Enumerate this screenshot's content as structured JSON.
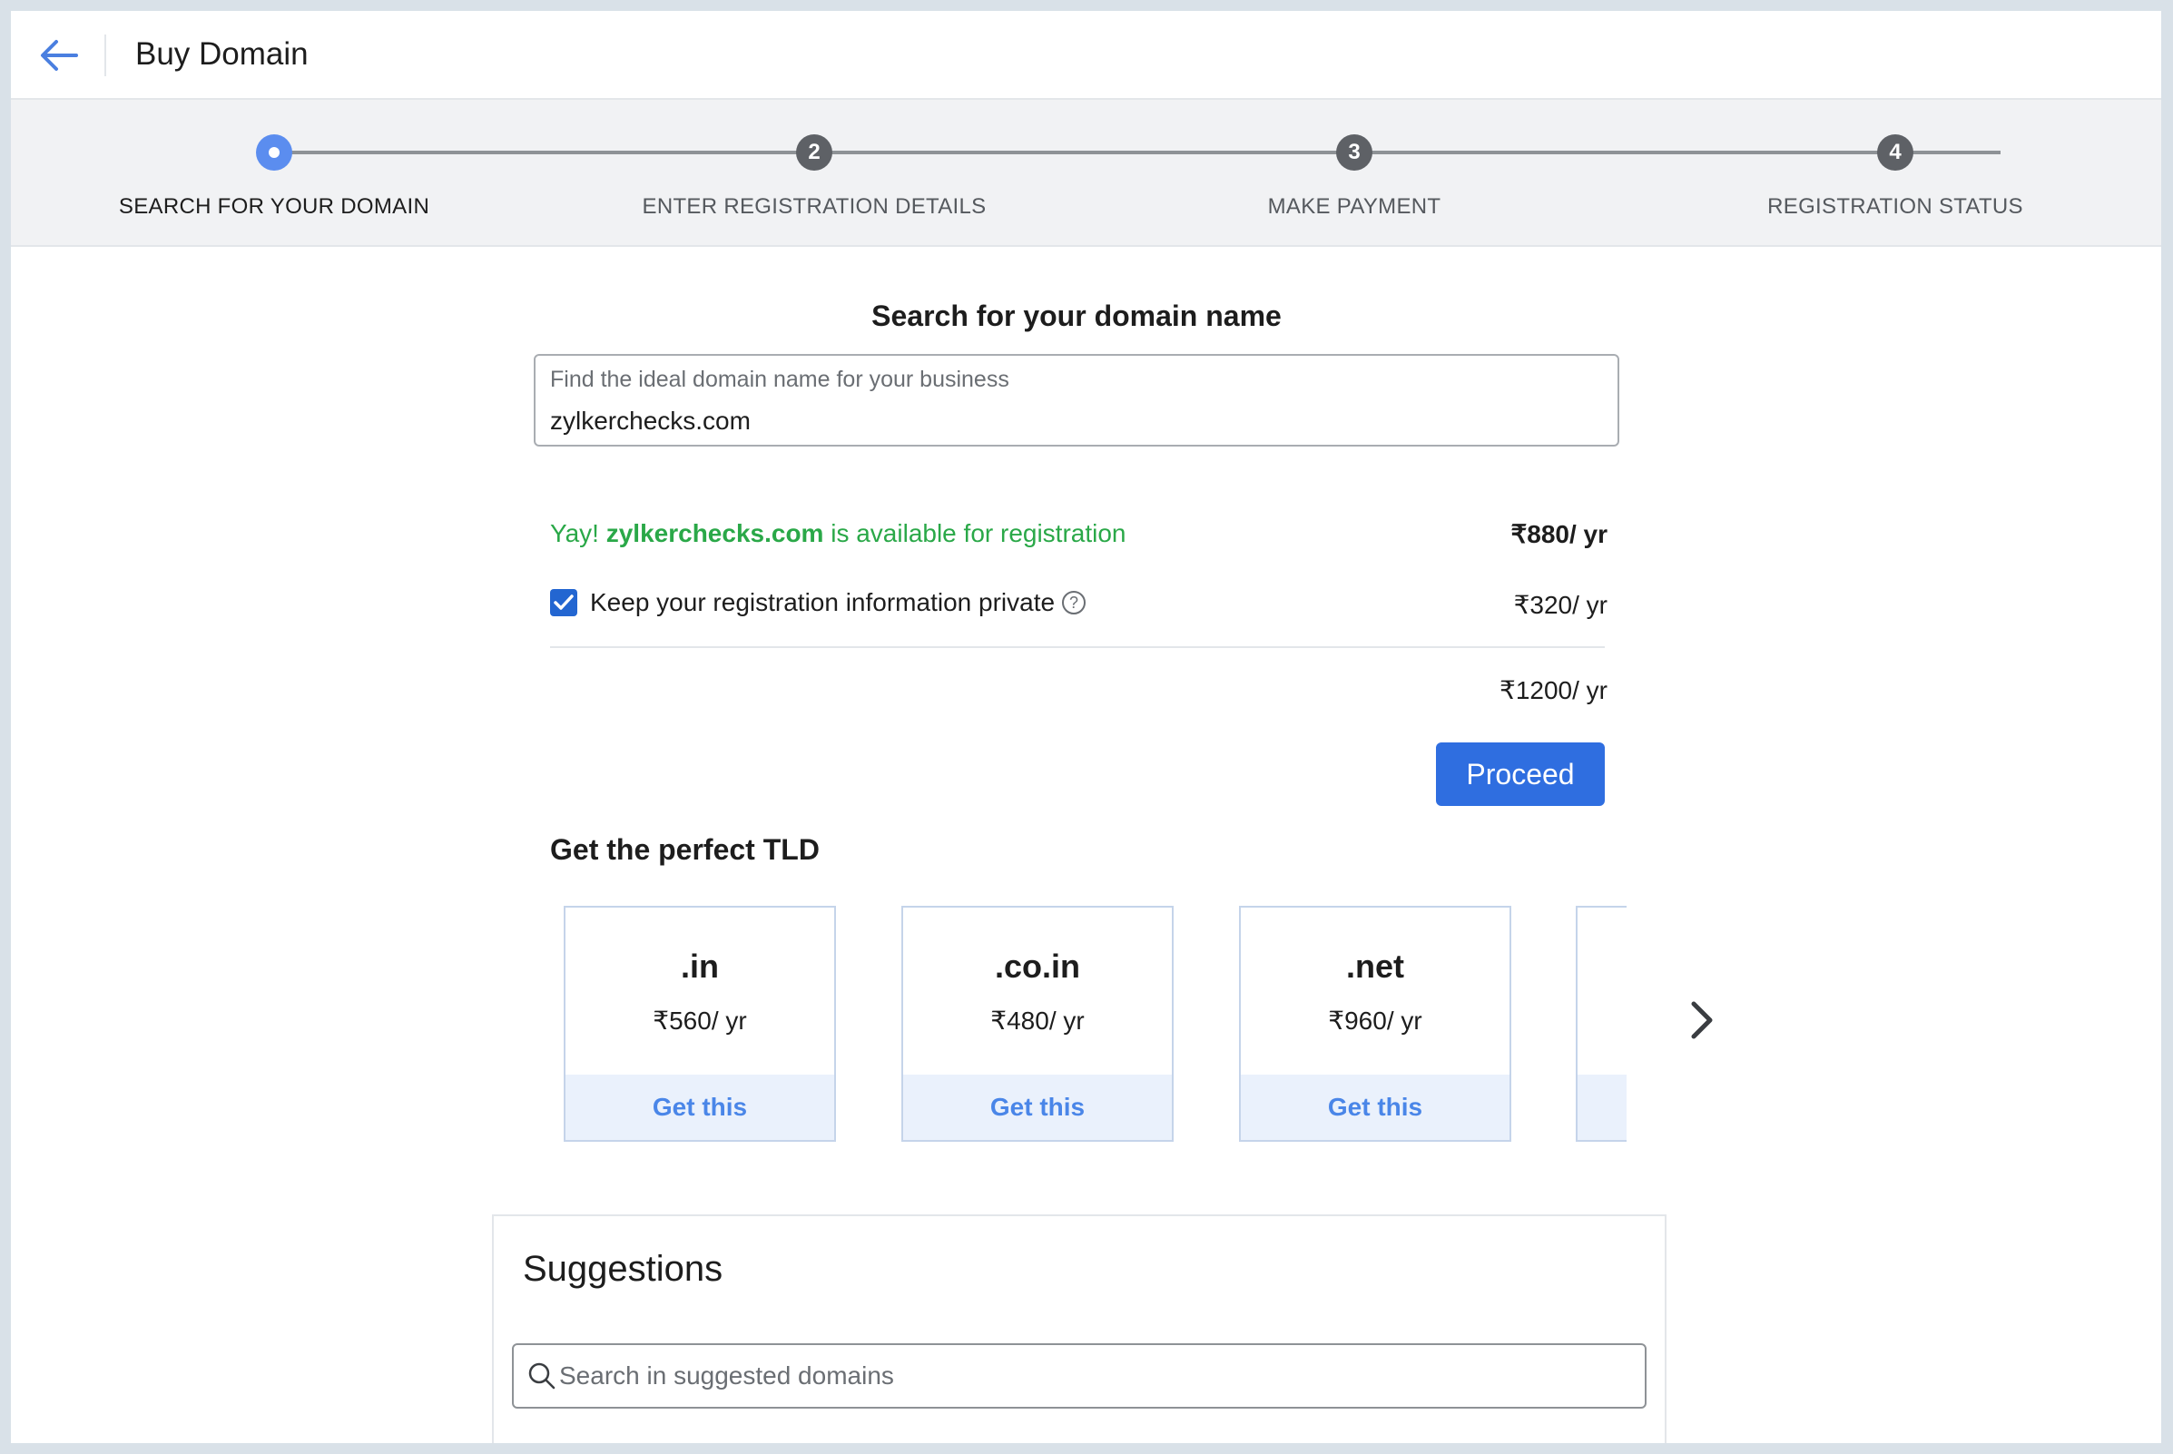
{
  "header": {
    "title": "Buy Domain",
    "back_icon": "arrow-left-icon"
  },
  "stepper": {
    "steps": [
      {
        "number": "",
        "label": "SEARCH FOR YOUR DOMAIN",
        "state": "active"
      },
      {
        "number": "2",
        "label": "ENTER REGISTRATION DETAILS",
        "state": "pending"
      },
      {
        "number": "3",
        "label": "MAKE PAYMENT",
        "state": "pending"
      },
      {
        "number": "4",
        "label": "REGISTRATION STATUS",
        "state": "pending"
      }
    ]
  },
  "search": {
    "title": "Search for your domain name",
    "field_label": "Find the ideal domain name for your business",
    "value": "zylkerchecks.com"
  },
  "availability": {
    "prefix": "Yay! ",
    "domain": "zylkerchecks.com",
    "suffix": " is available for registration",
    "price": "₹880/ yr"
  },
  "privacy": {
    "label": "Keep your registration information private",
    "checked": true,
    "help_icon": "question-circle-icon",
    "price": "₹320/ yr"
  },
  "total": {
    "price": "₹1200/ yr"
  },
  "proceed_label": "Proceed",
  "tld": {
    "title": "Get the perfect TLD",
    "cards": [
      {
        "name": ".in",
        "price": "₹560/ yr",
        "action": "Get this"
      },
      {
        "name": ".co.in",
        "price": "₹480/ yr",
        "action": "Get this"
      },
      {
        "name": ".net",
        "price": "₹960/ yr",
        "action": "Get this"
      }
    ],
    "next_icon": "chevron-right-icon"
  },
  "suggestions": {
    "title": "Suggestions",
    "search_placeholder": "Search in suggested domains",
    "search_icon": "search-icon"
  },
  "colors": {
    "accent": "#2f6ee0",
    "step_active": "#5b8def",
    "available_green": "#2aa848",
    "get_this_blue": "#4a86e8"
  }
}
